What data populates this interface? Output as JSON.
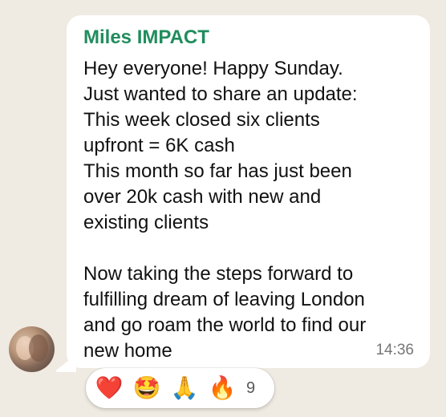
{
  "message": {
    "sender": "Miles IMPACT",
    "lines": [
      "Hey everyone! Happy Sunday.",
      "Just wanted to share an update:",
      "This week closed six clients",
      "upfront = 6K cash",
      "This month so far has just been",
      "over 20k cash with new and",
      "existing clients",
      "",
      "Now taking the steps forward to",
      "fulfilling dream of leaving London",
      "and go roam the world to find our",
      "new home"
    ],
    "time": "14:36"
  },
  "reactions": {
    "items": [
      {
        "emoji": "❤️",
        "icon": "red-heart-icon"
      },
      {
        "emoji": "🤩",
        "icon": "star-struck-face-icon"
      },
      {
        "emoji": "🙏",
        "icon": "folded-hands-icon"
      },
      {
        "emoji": "🔥",
        "icon": "fire-icon"
      }
    ],
    "count": "9"
  },
  "colors": {
    "background": "#efeae2",
    "bubble": "#ffffff",
    "sender": "#208d5d",
    "time": "#767676"
  }
}
